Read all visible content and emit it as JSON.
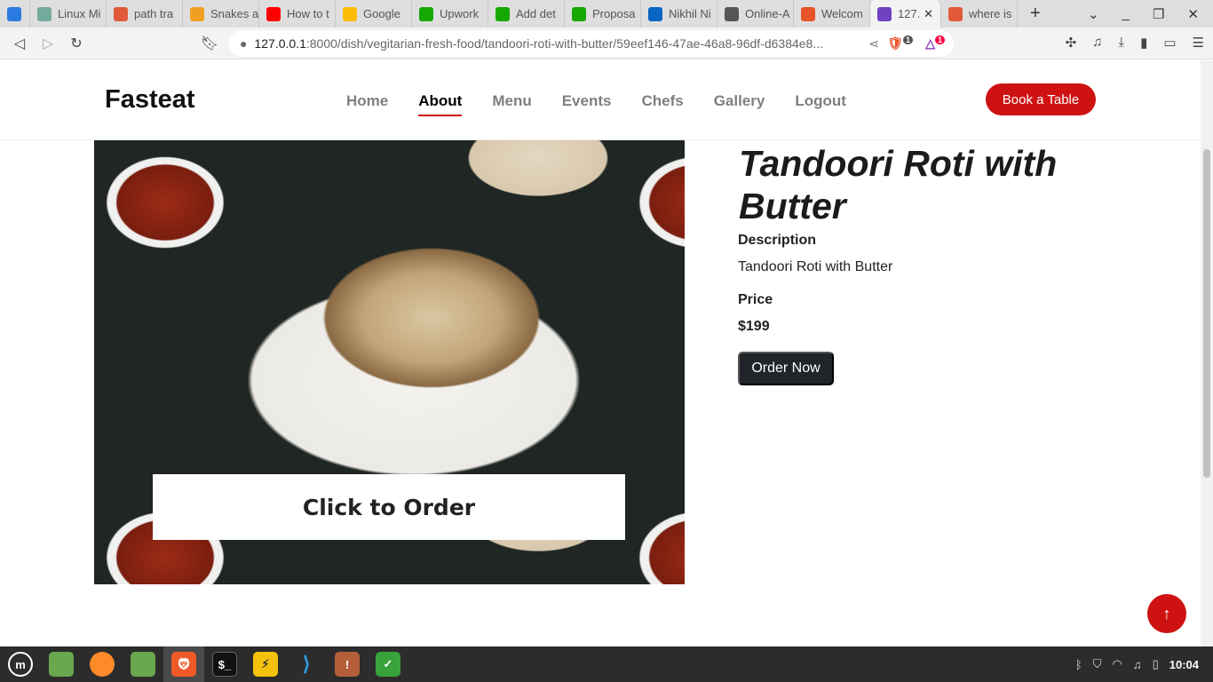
{
  "browser": {
    "tabs": [
      {
        "label": "",
        "color": "#2a7ae2",
        "icon": "bitwarden-icon"
      },
      {
        "label": "Linux Mi",
        "color": "#74aa9c",
        "icon": "chatgpt-icon"
      },
      {
        "label": "path tra",
        "color": "#e05a3a",
        "icon": "brave-icon"
      },
      {
        "label": "Snakes a",
        "color": "#f0a020",
        "icon": "leetcode-icon"
      },
      {
        "label": "How to t",
        "color": "#ff0000",
        "icon": "youtube-icon"
      },
      {
        "label": "Google",
        "color": "#fbbc04",
        "icon": "keep-icon"
      },
      {
        "label": "Upwork",
        "color": "#14a800",
        "icon": "upwork-icon"
      },
      {
        "label": "Add det",
        "color": "#14a800",
        "icon": "upwork-icon"
      },
      {
        "label": "Proposa",
        "color": "#14a800",
        "icon": "upwork-icon"
      },
      {
        "label": "Nikhil Ni",
        "color": "#0a66c2",
        "icon": "linkedin-icon"
      },
      {
        "label": "Online-A",
        "color": "#555555",
        "icon": "globe-icon"
      },
      {
        "label": "Welcom",
        "color": "#e8542a",
        "icon": "fire-icon"
      },
      {
        "label": "127.",
        "color": "#6f42c1",
        "icon": "bootstrap-icon",
        "active": true
      },
      {
        "label": "where is",
        "color": "#e05a3a",
        "icon": "brave-icon"
      }
    ],
    "url_host": "127.0.0.1",
    "url_rest": ":8000/dish/vegitarian-fresh-food/tandoori-roti-with-butter/59eef146-47ae-46a8-96df-d6384e8...",
    "shield_badge": "1",
    "rewards_badge": "1"
  },
  "site": {
    "logo": "Fasteat",
    "nav": [
      "Home",
      "About",
      "Menu",
      "Events",
      "Chefs",
      "Gallery",
      "Logout"
    ],
    "active_nav": "About",
    "book_label": "Book a Table",
    "accent": "#ce1212"
  },
  "dish": {
    "title": "Tandoori Roti with Butter",
    "description_label": "Description",
    "description": "Tandoori Roti with Butter",
    "price_label": "Price",
    "price": "$199",
    "order_label": "Order Now",
    "image_overlay": "Click to Order"
  },
  "taskbar": {
    "clock": "10:04"
  }
}
